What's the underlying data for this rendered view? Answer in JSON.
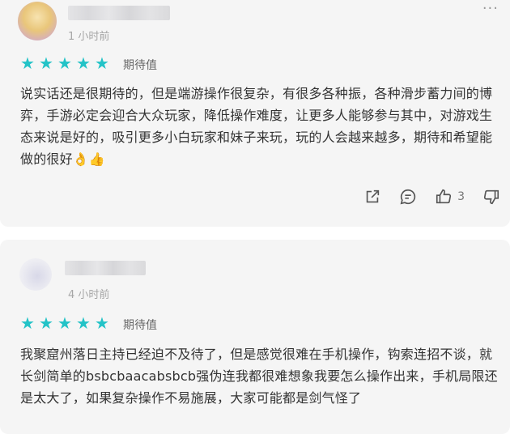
{
  "reviews": [
    {
      "time": "1 小时前",
      "rating": 5,
      "rating_label": "期待值",
      "content": "说实话还是很期待的，但是端游操作很复杂，有很多各种振，各种滑步蓄力间的博弈，手游必定会迎合大众玩家，降低操作难度，让更多人能够参与其中，对游戏生态来说是好的，吸引更多小白玩家和妹子来玩，玩的人会越来越多，期待和希望能做的很好👌👍",
      "likes": "3",
      "icons": [
        "share-icon",
        "comment-icon",
        "thumbs-up-icon",
        "thumbs-down-icon"
      ]
    },
    {
      "time": "4 小时前",
      "rating": 5,
      "rating_label": "期待值",
      "content": "我聚窟州落日主持已经迫不及待了，但是感觉很难在手机操作，钩索连招不谈，就长剑简单的bsbcbaacabsbcb强伪连我都很难想象我要怎么操作出来，手机局限还是太大了，如果复杂操作不易施展，大家可能都是剑气怪了"
    }
  ],
  "colors": {
    "star": "#23c3c7",
    "card_bg": "#f5f5f5"
  }
}
